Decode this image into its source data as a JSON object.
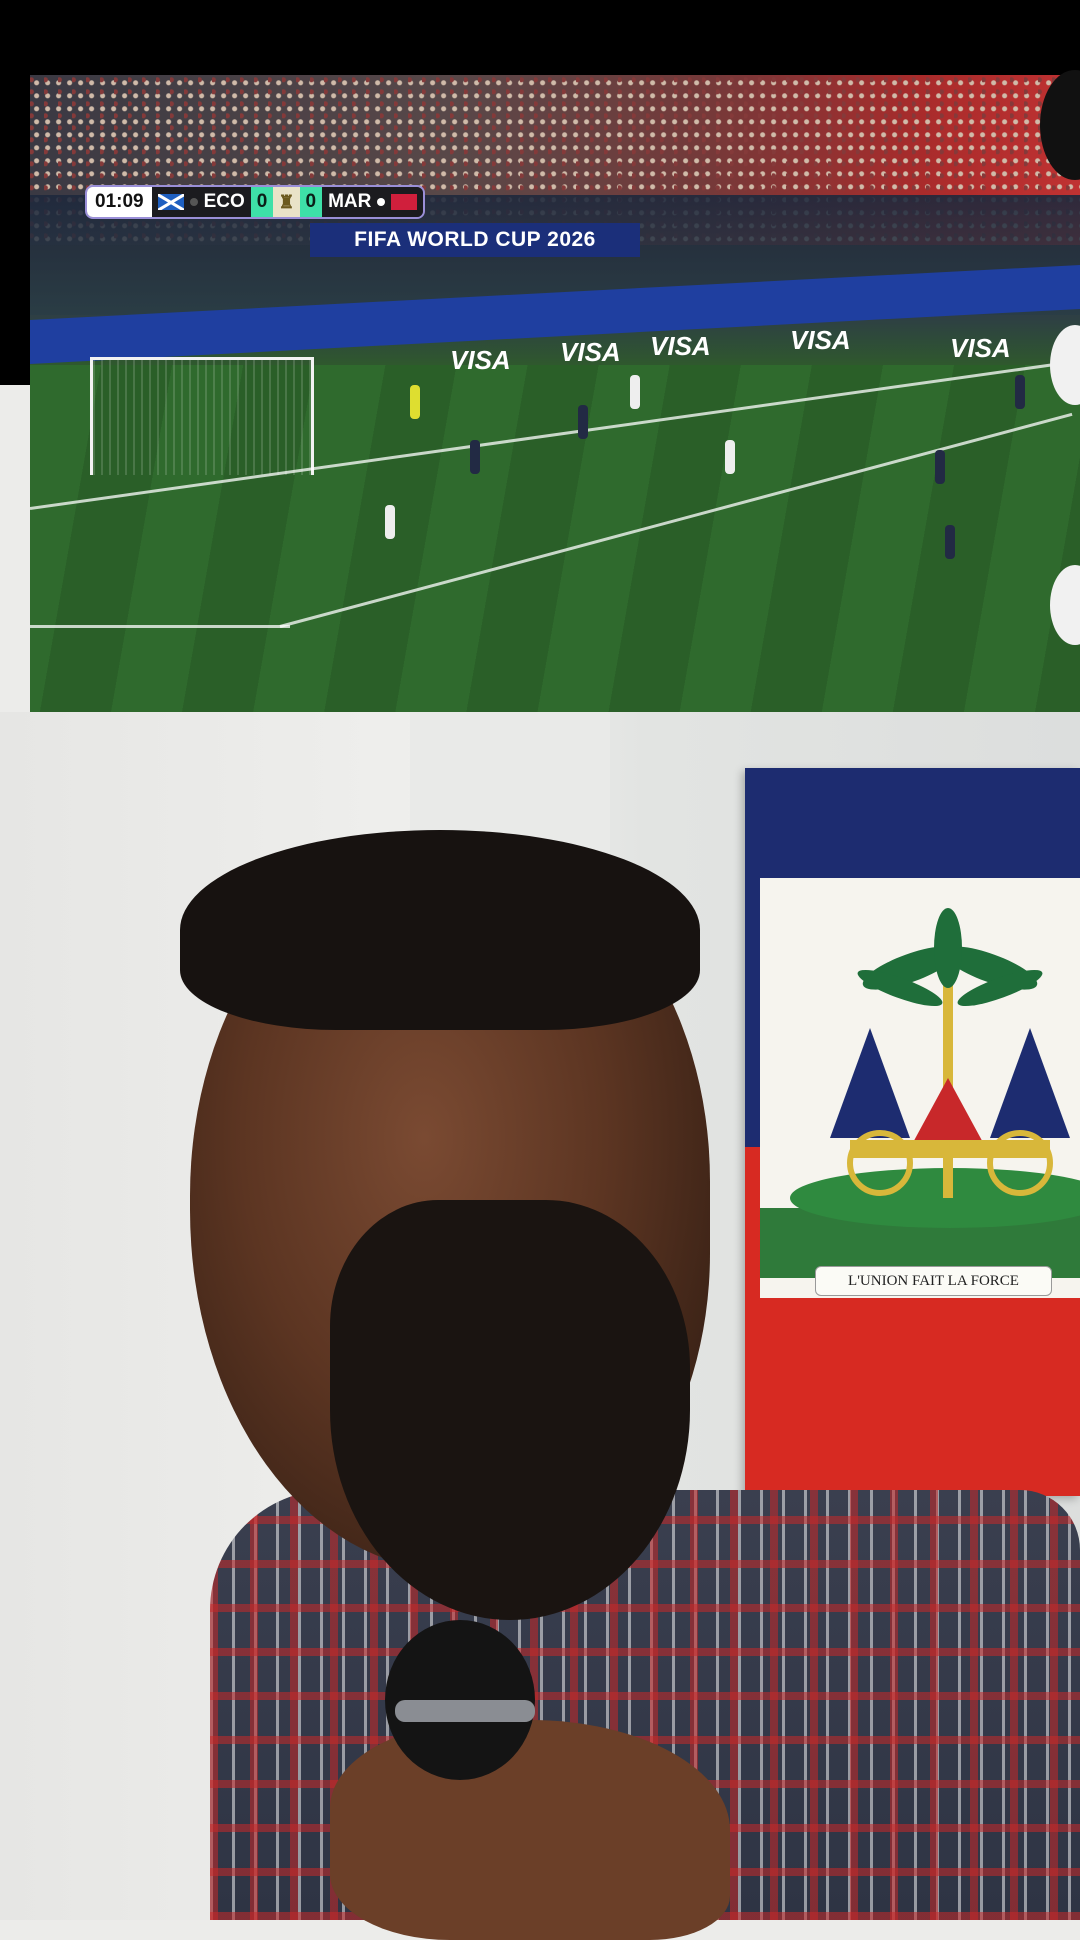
{
  "video": {
    "scorebug": {
      "clock": "01:09",
      "home_team": "ECO",
      "home_score": "0",
      "away_score": "0",
      "away_team": "MAR"
    },
    "banner_text": "FIFA WORLD CUP 2026",
    "ad_text": "VISA"
  },
  "flag": {
    "motto": "L'UNION FAIT LA FORCE"
  },
  "colors": {
    "score_green": "#3ee0a8",
    "flag_blue": "#1d2c70",
    "flag_red": "#d72a22",
    "banner_blue": "#1b2f7a"
  }
}
